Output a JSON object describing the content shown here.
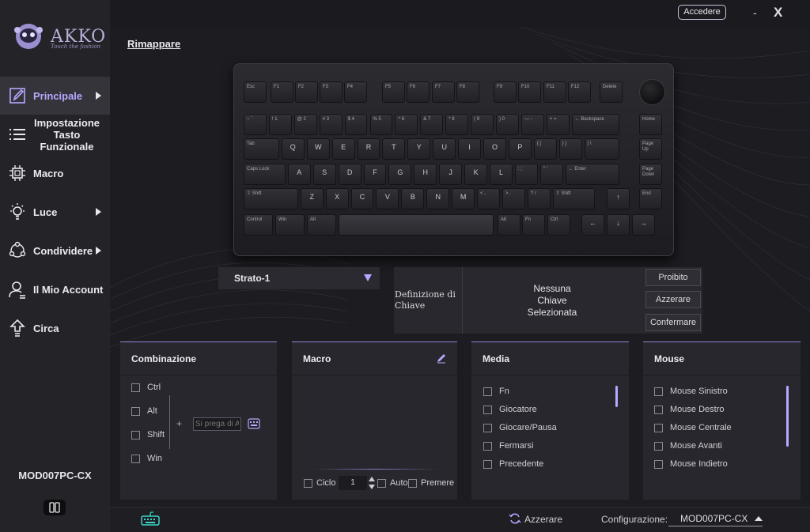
{
  "brand": {
    "name": "AKKO",
    "tagline": "Touch the fashion"
  },
  "header": {
    "login_label": "Accedere",
    "minimize_label": "-",
    "close_label": "X"
  },
  "page": {
    "title": "Rimappare"
  },
  "sidebar": {
    "items": [
      {
        "label": "Principale",
        "icon": "pencil-icon",
        "active": true,
        "has_arrow": true
      },
      {
        "label": "Impostazione Tasto Funzionale",
        "icon": "list-icon",
        "active": false,
        "has_arrow": false
      },
      {
        "label": "Macro",
        "icon": "chip-icon",
        "active": false,
        "has_arrow": false
      },
      {
        "label": "Luce",
        "icon": "bulb-icon",
        "active": false,
        "has_arrow": true
      },
      {
        "label": "Condividere",
        "icon": "share-icon",
        "active": false,
        "has_arrow": true
      },
      {
        "label": "Il Mio Account",
        "icon": "user-icon",
        "active": false,
        "has_arrow": false
      },
      {
        "label": "Circa",
        "icon": "upload-icon",
        "active": false,
        "has_arrow": false
      }
    ],
    "device_name": "MOD007PC-CX"
  },
  "keyboard": {
    "rows": [
      [
        "Esc",
        "F1",
        "F2",
        "F3",
        "F4",
        "F5",
        "F6",
        "F7",
        "F8",
        "F9",
        "F10",
        "F11",
        "F12",
        "Delete"
      ],
      [
        "~ `",
        "! 1",
        "@ 2",
        "# 3",
        "$ 4",
        "% 5",
        "^ 6",
        "& 7",
        "* 8",
        "( 9",
        ") 0",
        "— -",
        "+ =",
        "← Backspace",
        "Home"
      ],
      [
        "Tab",
        "Q",
        "W",
        "E",
        "R",
        "T",
        "Y",
        "U",
        "I",
        "O",
        "P",
        "{ [",
        "} ]",
        "| \\",
        "Page Up"
      ],
      [
        "Caps Lock",
        "A",
        "S",
        "D",
        "F",
        "G",
        "H",
        "J",
        "K",
        "L",
        ": ;",
        "\" '",
        "← Enter",
        "Page Down"
      ],
      [
        "⇧ Shift",
        "Z",
        "X",
        "C",
        "V",
        "B",
        "N",
        "M",
        "< ,",
        "> .",
        "? /",
        "⇧ Shift",
        "↑",
        "End"
      ],
      [
        "Control",
        "Win",
        "Alt",
        "",
        "Alt",
        "Fn",
        "Ctrl",
        "←",
        "↓",
        "→"
      ]
    ]
  },
  "layer": {
    "selected": "Strato-1"
  },
  "key_definition": {
    "label": "Definizione di Chiave",
    "status": "Nessuna Chiave Selezionata",
    "buttons": {
      "forbid": "Proibito",
      "reset": "Azzerare",
      "confirm": "Confermare"
    }
  },
  "panels": {
    "combination": {
      "title": "Combinazione",
      "modifiers": [
        "Ctrl",
        "Alt",
        "Shift",
        "Win"
      ],
      "plus": "+",
      "input_placeholder": "Si prega di A"
    },
    "macro": {
      "title": "Macro",
      "cycle_label": "Ciclo",
      "cycle_value": "1",
      "auto_label": "Auto",
      "press_label": "Premere"
    },
    "media": {
      "title": "Media",
      "items": [
        "Fn",
        "Giocatore",
        "Giocare/Pausa",
        "Fermarsi",
        "Precedente"
      ]
    },
    "mouse": {
      "title": "Mouse",
      "items": [
        "Mouse Sinistro",
        "Mouse Destro",
        "Mouse Centrale",
        "Mouse Avanti",
        "Mouse Indietro"
      ]
    }
  },
  "footer": {
    "reset_label": "Azzerare",
    "config_label": "Configurazione:",
    "config_value": "MOD007PC-CX"
  },
  "colors": {
    "accent": "#b8a8ff",
    "background": "#1c1c21",
    "sidebar": "#232328",
    "panel": "#27272d",
    "keyboard_icon": "#3ad6c8"
  }
}
